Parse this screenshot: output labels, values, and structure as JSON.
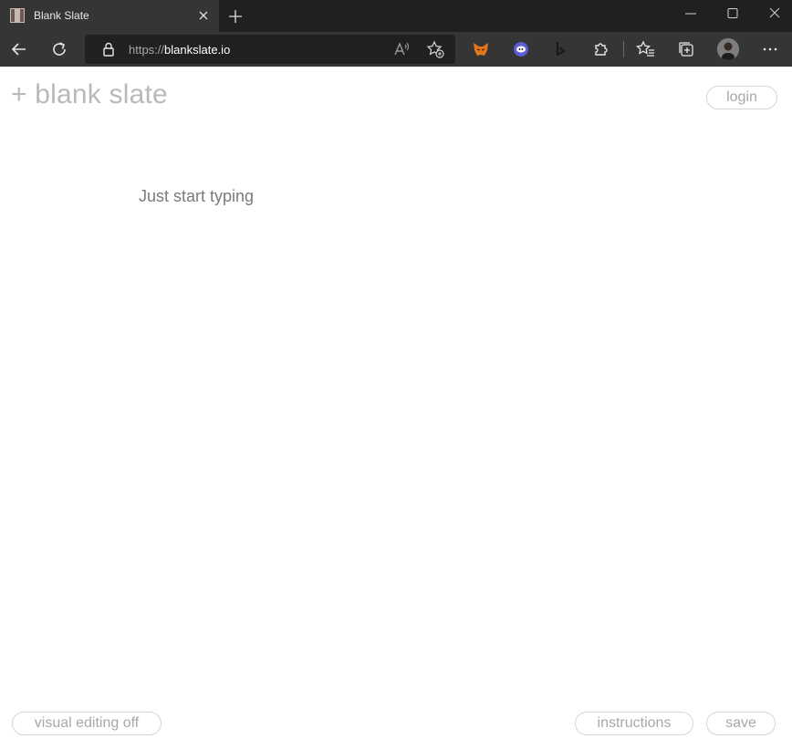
{
  "browser": {
    "tab_title": "Blank Slate",
    "url_scheme": "https://",
    "url_host": "blankslate.io"
  },
  "page": {
    "logo_text": "+ blank slate",
    "login_label": "login",
    "editor_placeholder": "Just start typing",
    "visual_editing_label": "visual editing off",
    "instructions_label": "instructions",
    "save_label": "save"
  },
  "icons": {
    "extensions": [
      "metamask-fox-icon",
      "ghost-extension-icon",
      "bing-icon",
      "puzzle-extensions-icon"
    ]
  }
}
